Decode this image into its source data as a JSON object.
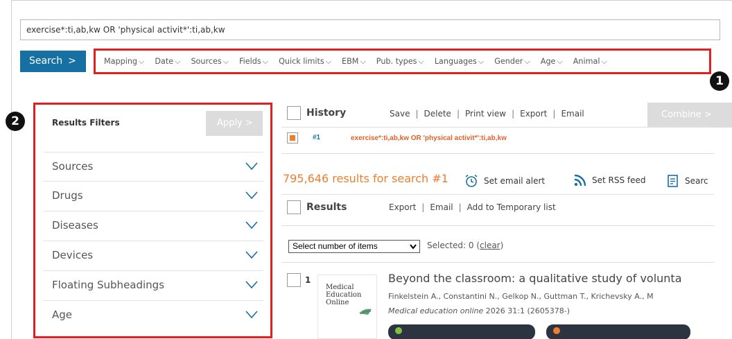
{
  "search": {
    "query": "exercise*:ti,ab,kw OR 'physical activit*':ti,ab,kw",
    "button_label": "Search",
    "button_chevron": ">"
  },
  "filter_bar": {
    "items": [
      "Mapping",
      "Date",
      "Sources",
      "Fields",
      "Quick limits",
      "EBM",
      "Pub. types",
      "Languages",
      "Gender",
      "Age",
      "Animal"
    ]
  },
  "badges": [
    "1",
    "2"
  ],
  "results_filters": {
    "title": "Results Filters",
    "apply_label": "Apply >",
    "items": [
      "Sources",
      "Drugs",
      "Diseases",
      "Devices",
      "Floating Subheadings",
      "Age"
    ]
  },
  "history": {
    "label": "History",
    "actions": [
      "Save",
      "Delete",
      "Print view",
      "Export",
      "Email"
    ],
    "combine_label": "Combine >",
    "row": {
      "number": "#1",
      "query": "exercise*:ti,ab,kw OR 'physical activit*':ti,ab,kw"
    }
  },
  "results_summary": {
    "count_text": "795,646 results for search #1",
    "email_alert": "Set email alert",
    "rss_feed": "Set RSS feed",
    "search_info": "Searc"
  },
  "results": {
    "label": "Results",
    "actions": [
      "Export",
      "Email",
      "Add to Temporary list"
    ]
  },
  "selection": {
    "select_label": "Select number of items",
    "selected_text": "Selected:  0",
    "clear_label": "clear"
  },
  "item": {
    "number": "1",
    "journal_thumb": "Medical Education Online",
    "title": "Beyond the classroom: a qualitative study of volunta",
    "authors": "Finkelstein A., Constantini N., Gelkop N., Guttman T., Krichevsky A., M",
    "journal": "Medical education online",
    "citation": " 2026 31:1 (2605378-)"
  },
  "colors": {
    "accent_blue": "#1670a2",
    "orange": "#ef7d2d",
    "highlight_red": "#e0201f",
    "disabled_gray": "#dcdcdc"
  }
}
